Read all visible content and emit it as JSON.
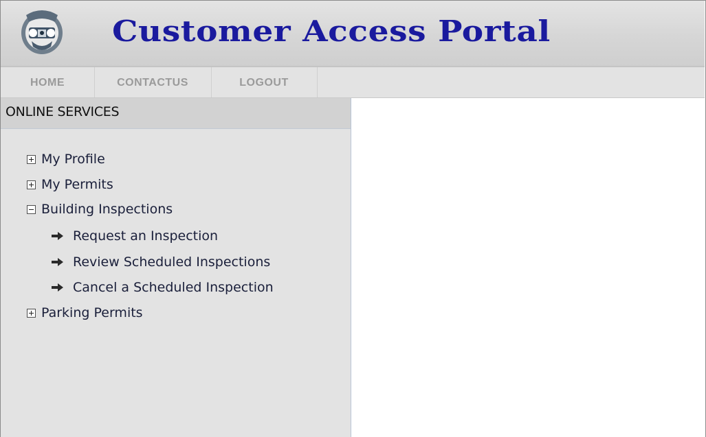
{
  "header": {
    "logo_icon": "city-seal-icon",
    "title": "Customer Access Portal",
    "title_color": "#1a1a9e"
  },
  "nav": {
    "items": [
      {
        "label": "HOME"
      },
      {
        "label": "CONTACTUS"
      },
      {
        "label": "LOGOUT"
      }
    ]
  },
  "sidebar": {
    "title": "ONLINE SERVICES",
    "items": [
      {
        "label": "My Profile",
        "state": "collapsed",
        "icon": "plus-box-icon"
      },
      {
        "label": "My Permits",
        "state": "collapsed",
        "icon": "plus-box-icon"
      },
      {
        "label": "Building Inspections",
        "state": "expanded",
        "icon": "minus-box-icon",
        "children": [
          {
            "label": "Request an Inspection",
            "icon": "arrow-right-icon"
          },
          {
            "label": "Review Scheduled Inspections",
            "icon": "arrow-right-icon"
          },
          {
            "label": "Cancel a Scheduled Inspection",
            "icon": "arrow-right-icon"
          }
        ]
      },
      {
        "label": "Parking Permits",
        "state": "collapsed",
        "icon": "plus-box-icon"
      }
    ]
  }
}
